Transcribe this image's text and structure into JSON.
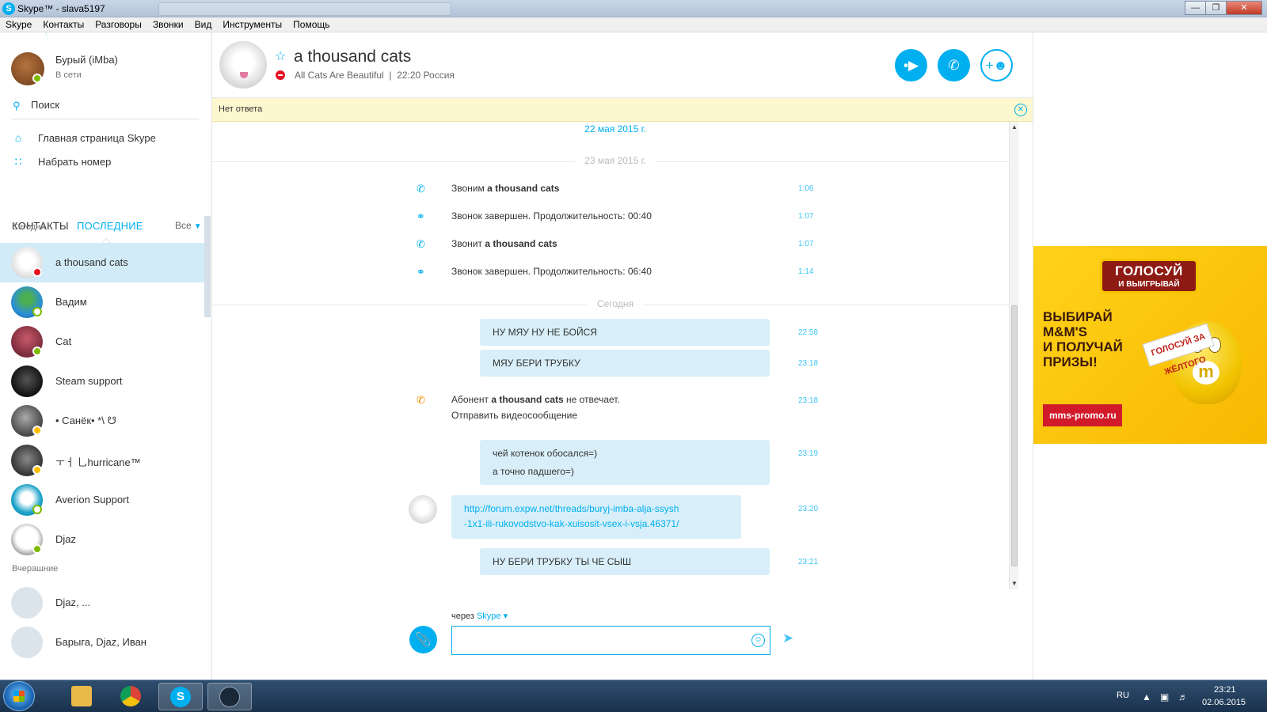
{
  "window": {
    "title": "Skype™ - slava5197",
    "app_icon": "S",
    "minimize": "—",
    "maximize": "❐",
    "close": "✕"
  },
  "menu": [
    "Skype",
    "Контакты",
    "Разговоры",
    "Звонки",
    "Вид",
    "Инструменты",
    "Помощь"
  ],
  "user": {
    "name": "Бурый (iMba)",
    "status": "В сети"
  },
  "search": {
    "label": "Поиск"
  },
  "nav": {
    "home": "Главная страница Skype",
    "dial": "Набрать номер"
  },
  "tabs": {
    "contacts": "КОНТАКТЫ",
    "recent": "ПОСЛЕДНИЕ",
    "filter": "Все"
  },
  "sections": {
    "today": "Сегодня",
    "yesterday": "Вчерашние"
  },
  "contacts_today": [
    {
      "name": "a thousand cats",
      "presence": "busy"
    },
    {
      "name": "Вадим",
      "presence": "online-ring"
    },
    {
      "name": "Cat",
      "presence": "online"
    },
    {
      "name": "Steam support",
      "presence": "none"
    },
    {
      "name": "• Санёк• *\\ ☋",
      "presence": "away"
    },
    {
      "name": "ㅜㅓ 乚hurricane™",
      "presence": "away"
    },
    {
      "name": "Averion Support",
      "presence": "online-ring"
    },
    {
      "name": "Djaz",
      "presence": "online"
    }
  ],
  "contacts_yesterday": [
    {
      "name": "Djaz, ..."
    },
    {
      "name": "Барыга, Djaz, Иван"
    }
  ],
  "chat": {
    "title": "a thousand cats",
    "mood": "All Cats Are Beautiful",
    "local_time": "22:20 Россия"
  },
  "notification": {
    "text": "Нет ответа"
  },
  "messages": {
    "date1": "22 мая 2015 г.",
    "date2": "23 мая 2015 г.",
    "date3": "Сегодня",
    "calls": [
      {
        "prefix": "Звоним ",
        "bold": "a thousand cats",
        "suffix": "",
        "time": "1:06"
      },
      {
        "prefix": "Звонок завершен. Продолжительность: 00:40",
        "bold": "",
        "suffix": "",
        "time": "1:07"
      },
      {
        "prefix": "Звонит ",
        "bold": "a thousand cats",
        "suffix": "",
        "time": "1:07"
      },
      {
        "prefix": "Звонок завершен. Продолжительность: 06:40",
        "bold": "",
        "suffix": "",
        "time": "1:14"
      }
    ],
    "sent1": {
      "text": "НУ МЯУ НУ НЕ БОЙСЯ",
      "time": "22:58"
    },
    "sent2": {
      "text": "МЯУ БЕРИ ТРУБКУ",
      "time": "23:18"
    },
    "missed": {
      "prefix": "Абонент ",
      "bold": "a thousand cats",
      "suffix": " не отвечает.",
      "link": "Отправить видеосообщение",
      "time": "23:18"
    },
    "sent3": {
      "line1": "чей котенок обосался=)",
      "line2": "а точно падшего=)",
      "time": "23:19"
    },
    "received": {
      "line1": "http://forum.expw.net/threads/buryj-imba-alja-ssysh",
      "line2": "-1x1-ili-rukovodstvo-kak-xuisosit-vsex-i-vsja.46371/",
      "time": "23:20"
    },
    "sent4": {
      "text": "НУ БЕРИ ТРУБКУ ТЫ ЧЕ СЫШ",
      "time": "23:21"
    }
  },
  "composer": {
    "via_label": "через ",
    "via_service": "Skype",
    "placeholder": ""
  },
  "ad": {
    "logo_line1": "ГОЛОСУЙ",
    "logo_line2": "И ВЫИГРЫВАЙ",
    "line1": "ВЫБИРАЙ",
    "line2": "M&M'S",
    "line3": "И ПОЛУЧАЙ",
    "line4": "ПРИЗЫ!",
    "sign": "ГОЛОСУЙ ЗА ЖЁЛТОГО",
    "mascot_letter": "m",
    "button": "mms-promo.ru"
  },
  "taskbar": {
    "language": "RU",
    "time": "23:21",
    "date": "02.06.2015"
  },
  "colors": {
    "accent": "#00aff0",
    "selected": "#d2ebf8",
    "notification": "#fdf7cf",
    "online": "#7fba00",
    "away": "#ffbf00",
    "busy": "#e81123"
  }
}
